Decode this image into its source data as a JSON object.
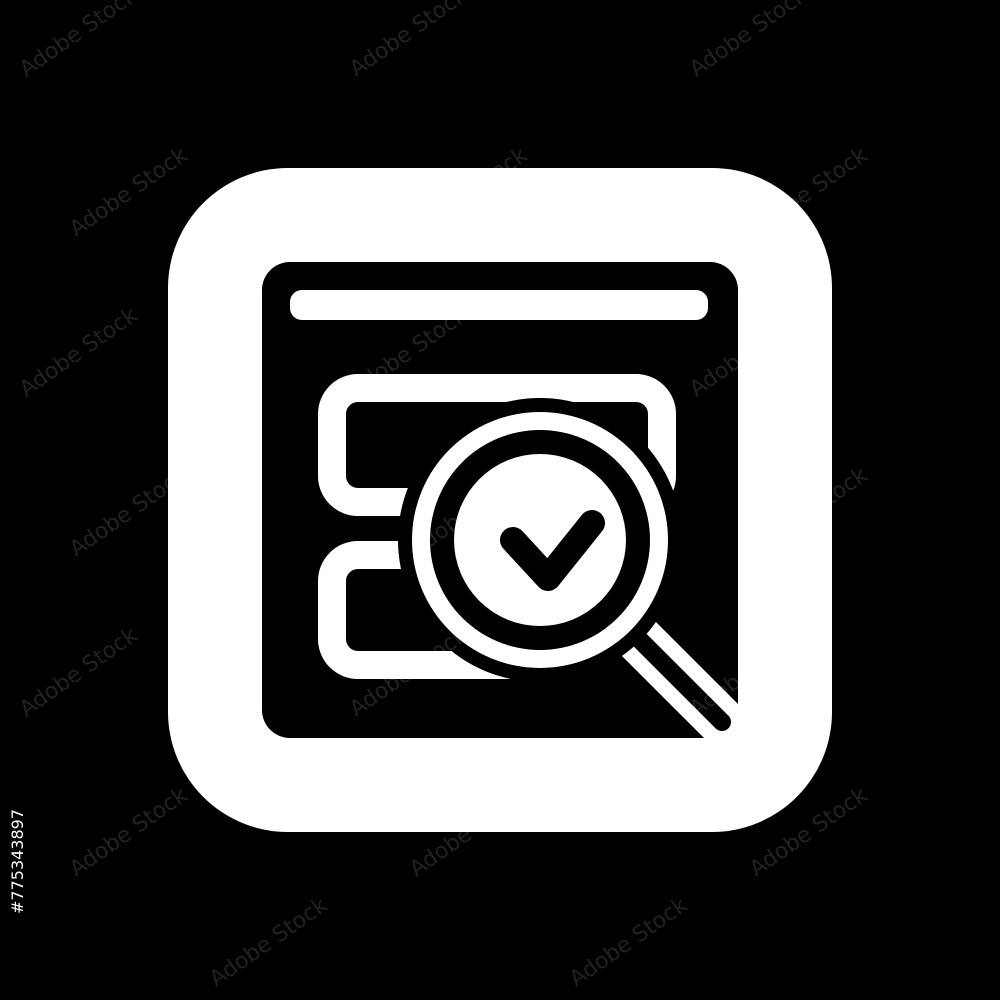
{
  "icon": {
    "name": "database-search-check-icon",
    "foreground": "#ffffff",
    "background": "#000000",
    "parts": [
      "rounded-square-frame",
      "window-panel",
      "server-stack",
      "magnifier-icon",
      "checkmark-icon"
    ]
  },
  "watermark": {
    "text": "Adobe Stock"
  },
  "stock_id": "#775343897"
}
